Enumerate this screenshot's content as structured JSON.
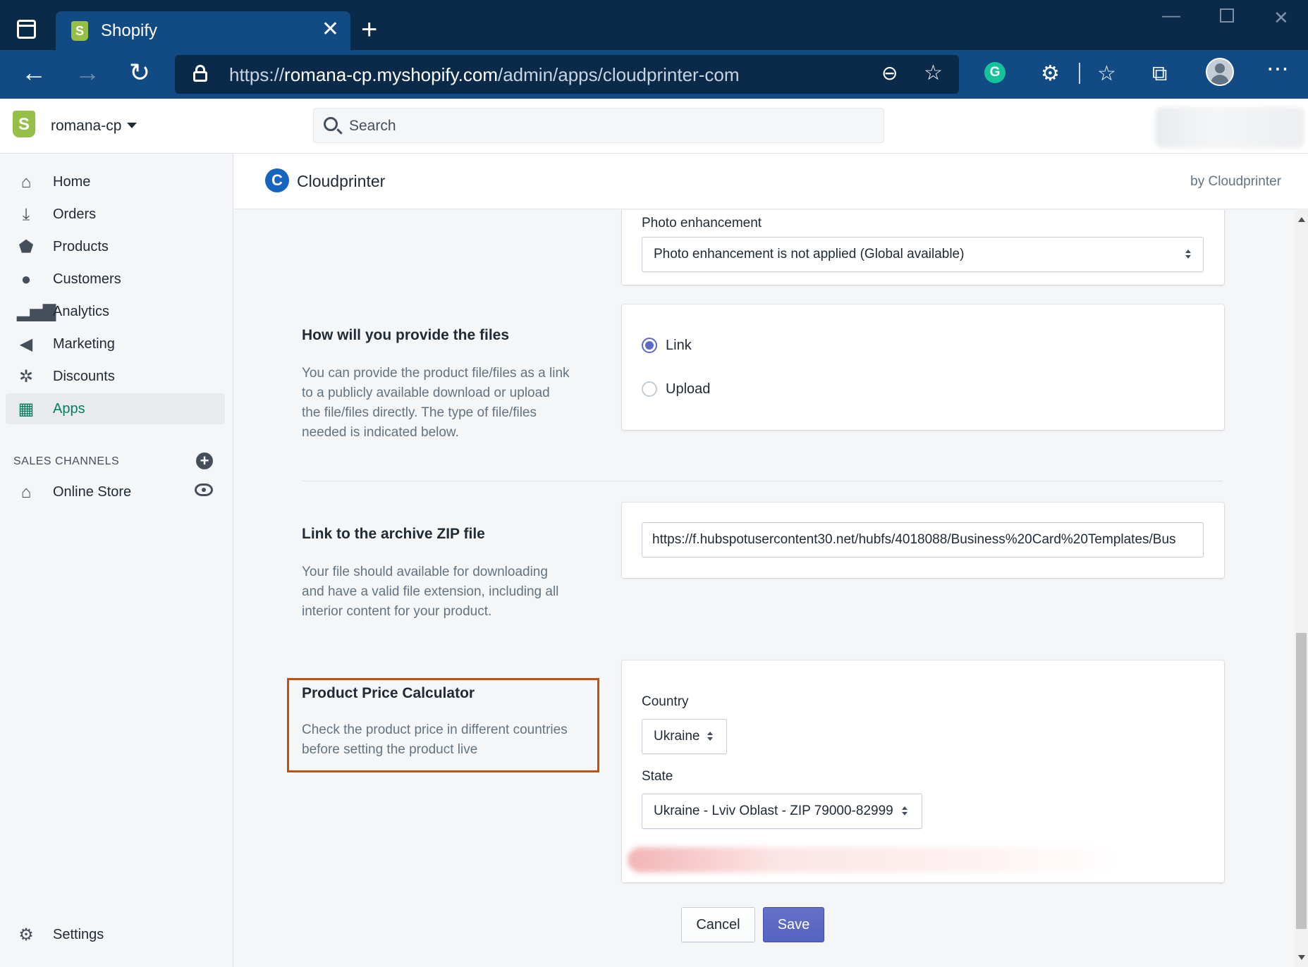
{
  "browser": {
    "tab_title": "Shopify",
    "url_prefix": "https://",
    "url_host": "romana-cp.myshopify.com",
    "url_path": "/admin/apps/cloudprinter-com"
  },
  "topbar": {
    "store_name": "romana-cp",
    "search_placeholder": "Search"
  },
  "sidebar": {
    "items": [
      {
        "label": "Home",
        "icon": "home-icon"
      },
      {
        "label": "Orders",
        "icon": "orders-icon"
      },
      {
        "label": "Products",
        "icon": "tag-icon"
      },
      {
        "label": "Customers",
        "icon": "person-icon"
      },
      {
        "label": "Analytics",
        "icon": "bar-chart-icon"
      },
      {
        "label": "Marketing",
        "icon": "megaphone-icon"
      },
      {
        "label": "Discounts",
        "icon": "discount-icon"
      },
      {
        "label": "Apps",
        "icon": "apps-icon",
        "active": true
      }
    ],
    "sales_channels_heading": "SALES CHANNELS",
    "online_store": "Online Store",
    "settings": "Settings"
  },
  "app_header": {
    "title": "Cloudprinter",
    "by": "by Cloudprinter"
  },
  "photo_enhancement": {
    "label": "Photo enhancement",
    "selected": "Photo enhancement is not applied (Global available)"
  },
  "files_section": {
    "title": "How will you provide the files",
    "desc_lines": [
      "You can provide the product file/files as a link",
      "to a publicly available download or upload",
      "the file/files directly. The type of file/files",
      "needed is indicated below."
    ],
    "options": [
      {
        "label": "Link",
        "checked": true
      },
      {
        "label": "Upload",
        "checked": false
      }
    ]
  },
  "zip_section": {
    "title": "Link to the archive ZIP file",
    "desc_lines": [
      "Your file should available for downloading",
      "and have a valid file extension, including all",
      "interior content for your product."
    ],
    "value": "https://f.hubspotusercontent30.net/hubfs/4018088/Business%20Card%20Templates/Bus"
  },
  "price_calc": {
    "title": "Product Price Calculator",
    "desc_lines": [
      "Check the product price in different countries",
      "before setting the product live"
    ],
    "country_label": "Country",
    "country_value": "Ukraine",
    "state_label": "State",
    "state_value": "Ukraine - Lviv Oblast - ZIP 79000-82999"
  },
  "actions": {
    "cancel": "Cancel",
    "save": "Save"
  },
  "colors": {
    "accent": "#5c6ac4",
    "active_nav": "#007f5f",
    "highlight_border": "#c0520e",
    "browser_dark": "#0b2a4a",
    "browser_tab": "#124b84"
  }
}
